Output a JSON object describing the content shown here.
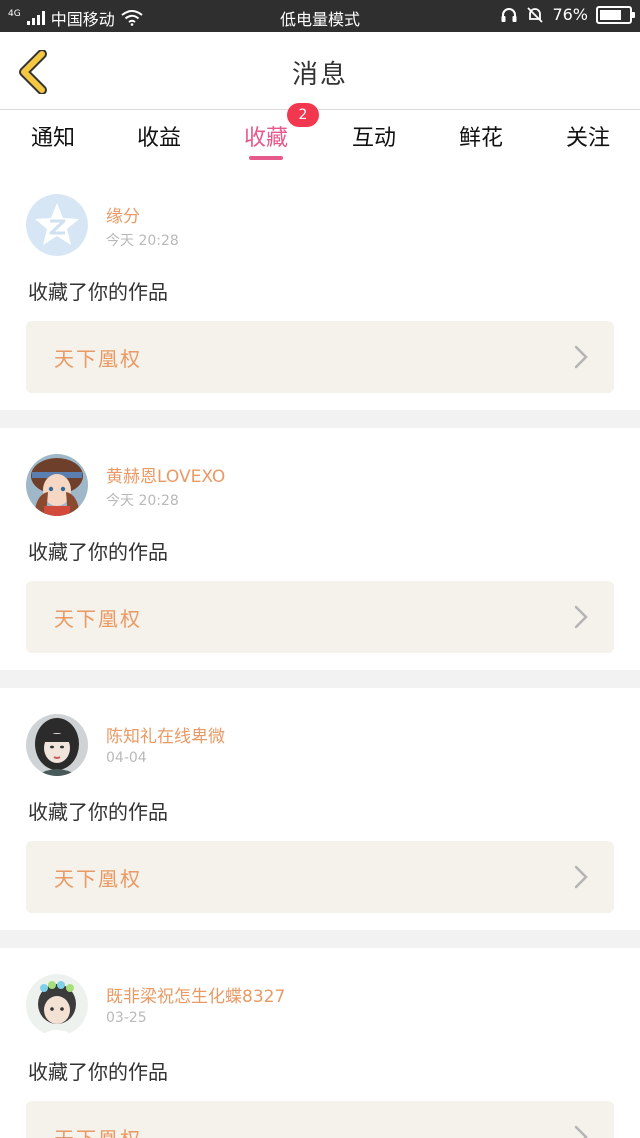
{
  "status_bar": {
    "network": "4G",
    "carrier": "中国移动",
    "mode": "低电量模式",
    "battery": "76%",
    "battery_level": 0.76
  },
  "header": {
    "title": "消息",
    "back_icon": "chevron-left-icon"
  },
  "tabs": [
    {
      "label": "通知"
    },
    {
      "label": "收益"
    },
    {
      "label": "收藏",
      "active": true,
      "badge": "2"
    },
    {
      "label": "互动"
    },
    {
      "label": "鲜花"
    },
    {
      "label": "关注"
    }
  ],
  "messages": [
    {
      "username": "缘分",
      "time": "今天 20:28",
      "action": "收藏了你的作品",
      "work_title": "天下凰权",
      "avatar": "qzone-logo"
    },
    {
      "username": "黄赫恩LOVEXO",
      "time": "今天 20:28",
      "action": "收藏了你的作品",
      "work_title": "天下凰权",
      "avatar": "anime-girl-portrait"
    },
    {
      "username": "陈知礼在线卑微",
      "time": "04-04",
      "action": "收藏了你的作品",
      "work_title": "天下凰权",
      "avatar": "girl-portrait"
    },
    {
      "username": "既非梁祝怎生化蝶8327",
      "time": "03-25",
      "action": "收藏了你的作品",
      "work_title": "天下凰权",
      "avatar": "girl-with-flower-crown"
    }
  ],
  "colors": {
    "accent": "#e5598b",
    "badge": "#f2384f",
    "name": "#e99a64",
    "card_bg": "#f4f2ea",
    "back_icon": "#f5c842"
  }
}
